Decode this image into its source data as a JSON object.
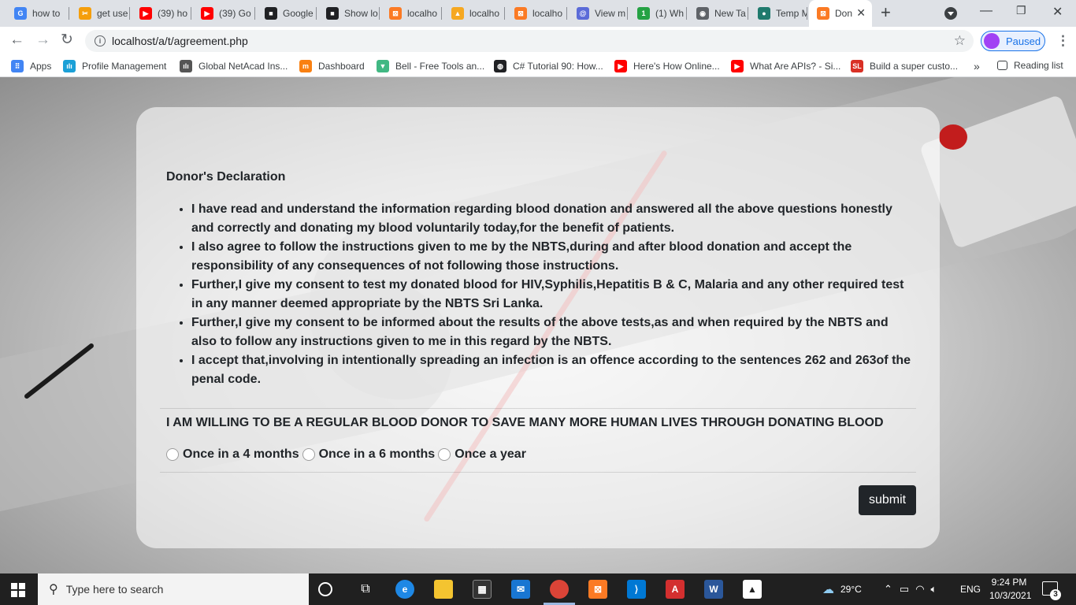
{
  "browser": {
    "tabs": [
      {
        "title": "how to",
        "icon": "google-icon",
        "color": "#4285f4",
        "glyph": "G"
      },
      {
        "title": "get use",
        "icon": "figma-icon",
        "color": "#f59e0b",
        "glyph": "✂"
      },
      {
        "title": "(39) ho",
        "icon": "youtube-icon",
        "color": "#ff0000",
        "glyph": "▶"
      },
      {
        "title": "(39) Go",
        "icon": "youtube-icon",
        "color": "#ff0000",
        "glyph": "▶"
      },
      {
        "title": "Google",
        "icon": "terminal-icon",
        "color": "#202124",
        "glyph": "■"
      },
      {
        "title": "Show lo",
        "icon": "terminal-icon",
        "color": "#202124",
        "glyph": "■"
      },
      {
        "title": "localho",
        "icon": "xampp-icon",
        "color": "#fb7a24",
        "glyph": "⊠"
      },
      {
        "title": "localho",
        "icon": "phpmyadmin-icon",
        "color": "#f6a821",
        "glyph": "▲"
      },
      {
        "title": "localho",
        "icon": "xampp-icon",
        "color": "#fb7a24",
        "glyph": "⊠"
      },
      {
        "title": "View m",
        "icon": "at-icon",
        "color": "#5b6bd8",
        "glyph": "@"
      },
      {
        "title": "(1) Wh",
        "icon": "whatsapp-icon",
        "color": "#25a244",
        "glyph": "1"
      },
      {
        "title": "New Ta",
        "icon": "chrome-icon",
        "color": "#5f6368",
        "glyph": "◉"
      },
      {
        "title": "Temp M",
        "icon": "temp-mail-icon",
        "color": "#1f7a6d",
        "glyph": "●"
      },
      {
        "title": "Don",
        "icon": "xampp-icon",
        "color": "#fb7a24",
        "glyph": "⊠"
      }
    ],
    "new_tab": "+",
    "close_tab": "✕",
    "url": "localhost/a/t/agreement.php",
    "profile_status": "Paused",
    "bookmarks": [
      {
        "label": "Apps",
        "icon": "apps-grid-icon",
        "color": "#4285f4",
        "glyph": "⠿"
      },
      {
        "label": "Profile Management",
        "icon": "cisco-icon",
        "color": "#1ba0d7",
        "glyph": "ılı"
      },
      {
        "label": "Global NetAcad Ins...",
        "icon": "cisco-icon",
        "color": "#555555",
        "glyph": "ılı"
      },
      {
        "label": "Dashboard",
        "icon": "moodle-icon",
        "color": "#f98012",
        "glyph": "m"
      },
      {
        "label": "Bell - Free Tools an...",
        "icon": "bell-vue-icon",
        "color": "#41b883",
        "glyph": "▼"
      },
      {
        "label": "C# Tutorial 90: How...",
        "icon": "globe-icon",
        "color": "#202124",
        "glyph": "◍"
      },
      {
        "label": "Here's How Online...",
        "icon": "youtube-icon",
        "color": "#ff0000",
        "glyph": "▶"
      },
      {
        "label": "What Are APIs? - Si...",
        "icon": "youtube-icon",
        "color": "#ff0000",
        "glyph": "▶"
      },
      {
        "label": "Build a super custo...",
        "icon": "sl-icon",
        "color": "#d93025",
        "glyph": "SL"
      }
    ],
    "more_bookmarks": "»",
    "reading_list": "Reading list"
  },
  "page": {
    "heading": "Donor's Declaration",
    "declarations": [
      "I have read and understand the information regarding blood donation and answered all the above questions honestly and correctly and donating my blood voluntarily today,for the benefit of patients.",
      "I also agree to follow the instructions given to me by the NBTS,during and after blood donation and accept the responsibility of any consequences of not following those instructions.",
      "Further,I give my consent to test my donated blood for HIV,Syphilis,Hepatitis B & C, Malaria and any other required test in any manner deemed appropriate by the NBTS Sri Lanka.",
      "Further,I give my consent to be informed about the results of the above tests,as and when required by the NBTS and also to follow any instructions given to me in this regard by the NBTS.",
      "I accept that,involving in intentionally spreading an infection is an offence according to the sentences 262 and 263of the penal code."
    ],
    "willing_text": "I AM WILLING TO BE A REGULAR BLOOD DONOR TO SAVE MANY MORE HUMAN LIVES THROUGH DONATING BLOOD",
    "frequency_options": [
      "Once in a 4 months",
      "Once in a 6 months",
      "Once a year"
    ],
    "submit_label": "submit"
  },
  "taskbar": {
    "search_placeholder": "Type here to search",
    "weather": "29°C",
    "language": "ENG",
    "time": "9:24 PM",
    "date": "10/3/2021",
    "notifications": "3"
  }
}
